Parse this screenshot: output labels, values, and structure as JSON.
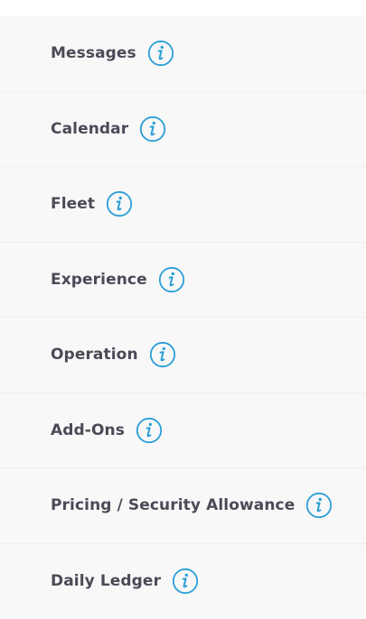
{
  "menu": {
    "accent_color": "#2a9fd6",
    "items": [
      {
        "label": "Messages",
        "icon": "info-icon"
      },
      {
        "label": "Calendar",
        "icon": "info-icon"
      },
      {
        "label": "Fleet",
        "icon": "info-icon"
      },
      {
        "label": "Experience",
        "icon": "info-icon"
      },
      {
        "label": "Operation",
        "icon": "info-icon"
      },
      {
        "label": "Add-Ons",
        "icon": "info-icon"
      },
      {
        "label": "Pricing / Security Allowance",
        "icon": "info-icon"
      },
      {
        "label": "Daily Ledger",
        "icon": "info-icon"
      }
    ]
  }
}
